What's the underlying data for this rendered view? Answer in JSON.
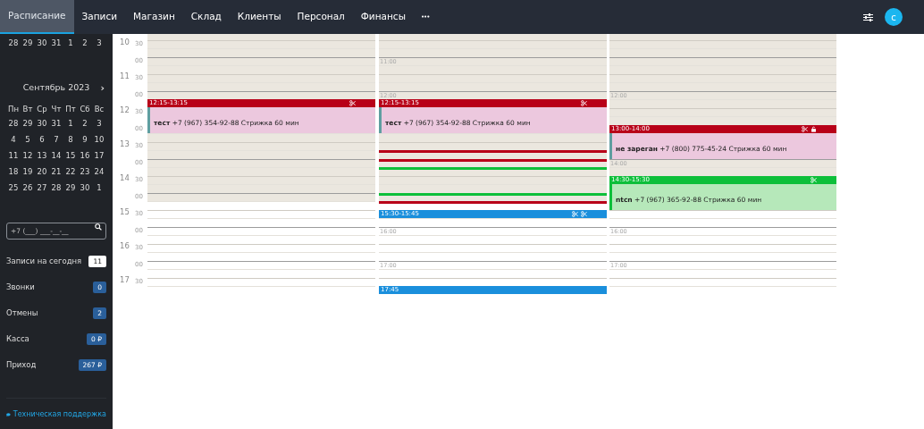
{
  "nav": {
    "tabs": [
      {
        "label": "Расписание",
        "selected": true
      },
      {
        "label": "Записи",
        "selected": false
      },
      {
        "label": "Магазин",
        "selected": false
      },
      {
        "label": "Склад",
        "selected": false
      },
      {
        "label": "Клиенты",
        "selected": false
      },
      {
        "label": "Персонал",
        "selected": false
      },
      {
        "label": "Финансы",
        "selected": false
      }
    ],
    "more": "•••",
    "avatar": "с"
  },
  "sidebar": {
    "prev_week": [
      "28",
      "29",
      "30",
      "31",
      "1",
      "2",
      "3"
    ],
    "calendar": {
      "title": "Сентябрь 2023",
      "next": "›",
      "weekdays": [
        "Пн",
        "Вт",
        "Ср",
        "Чт",
        "Пт",
        "Сб",
        "Вс"
      ],
      "weeks": [
        [
          "28",
          "29",
          "30",
          "31",
          "1",
          "2",
          "3"
        ],
        [
          "4",
          "5",
          "6",
          "7",
          "8",
          "9",
          "10"
        ],
        [
          "11",
          "12",
          "13",
          "14",
          "15",
          "16",
          "17"
        ],
        [
          "18",
          "19",
          "20",
          "21",
          "22",
          "23",
          "24"
        ],
        [
          "25",
          "26",
          "27",
          "28",
          "29",
          "30",
          "1"
        ]
      ]
    },
    "search": {
      "placeholder": "+7 (___) ___-__-__"
    },
    "stats": [
      {
        "label": "Записи на сегодня",
        "value": "11",
        "kind": "light"
      },
      {
        "label": "Звонки",
        "value": "0",
        "kind": "dark"
      },
      {
        "label": "Отмены",
        "value": "2",
        "kind": "dark"
      },
      {
        "label": "Касса",
        "value": "0 ₽",
        "kind": "dark"
      },
      {
        "label": "Приход",
        "value": "267 ₽",
        "kind": "dark"
      }
    ],
    "support": "Техническая поддержка"
  },
  "schedule": {
    "time_labels": [
      {
        "hour": "10",
        "minute": "30"
      },
      {
        "minute": "00"
      },
      {
        "hour": "11",
        "minute": "30"
      },
      {
        "minute": "00"
      },
      {
        "hour": "12",
        "minute": "30"
      },
      {
        "minute": "00"
      },
      {
        "hour": "13",
        "minute": "30"
      },
      {
        "minute": "00"
      },
      {
        "hour": "14",
        "minute": "30"
      },
      {
        "minute": "00"
      },
      {
        "hour": "15",
        "minute": "30"
      },
      {
        "minute": "00"
      },
      {
        "hour": "16",
        "minute": "30"
      },
      {
        "minute": "00"
      },
      {
        "hour": "17",
        "minute": "30"
      }
    ],
    "columns": [
      {
        "slots": [
          {
            "kind": "closed"
          },
          {
            "kind": "closed"
          },
          {
            "kind": "closed"
          },
          {
            "kind": "closed"
          },
          {
            "kind": "closed"
          },
          {
            "kind": "closed"
          },
          {
            "kind": "closed"
          },
          {
            "kind": "closed"
          },
          {
            "kind": "closed",
            "events": [
              {
                "kind": "full",
                "color": "#b80018",
                "time": "12:15-13:15",
                "client": "тест",
                "details": "+7 (967) 354-92-88 Стрижка 60 мин",
                "service": true,
                "master": false,
                "locked": false
              }
            ]
          },
          {
            "kind": "closed"
          },
          {
            "kind": "closed"
          },
          {
            "kind": "closed"
          },
          {
            "kind": "closed"
          },
          {
            "kind": "closed"
          },
          {
            "kind": "closed"
          },
          {
            "kind": "closed"
          },
          {
            "kind": "closed"
          },
          {
            "kind": "closed"
          },
          {
            "kind": "closed"
          },
          {
            "kind": "closed"
          },
          {
            "kind": "open"
          },
          {
            "kind": "open"
          },
          {
            "kind": "open"
          },
          {
            "kind": "open"
          },
          {
            "kind": "open"
          },
          {
            "kind": "open"
          },
          {
            "kind": "open"
          },
          {
            "kind": "open"
          },
          {
            "kind": "open"
          },
          {
            "kind": "open"
          },
          {
            "kind": "open"
          }
        ]
      },
      {
        "slots": [
          {
            "kind": "closed"
          },
          {
            "kind": "closed"
          },
          {
            "kind": "closed"
          },
          {
            "kind": "closed",
            "mark": "11:00"
          },
          {
            "kind": "closed"
          },
          {
            "kind": "closed"
          },
          {
            "kind": "closed"
          },
          {
            "kind": "closed",
            "mark": "12:00"
          },
          {
            "kind": "closed",
            "events": [
              {
                "kind": "full",
                "color": "#b80018",
                "time": "12:15-13:15",
                "client": "тест",
                "details": "+7 (967) 354-92-88 Стрижка 60 мин",
                "service": true,
                "master": false,
                "locked": false
              }
            ]
          },
          {
            "kind": "closed"
          },
          {
            "kind": "closed"
          },
          {
            "kind": "closed"
          },
          {
            "kind": "closed"
          },
          {
            "kind": "closed"
          },
          {
            "kind": "closed",
            "events": [
              {
                "kind": "collapsed",
                "color": "#b80018"
              }
            ]
          },
          {
            "kind": "closed",
            "events": [
              {
                "kind": "collapsed",
                "color": "#b80018"
              }
            ]
          },
          {
            "kind": "closed",
            "events": [
              {
                "kind": "collapsed",
                "color": "#0dbf3a"
              }
            ]
          },
          {
            "kind": "closed"
          },
          {
            "kind": "closed"
          },
          {
            "kind": "closed",
            "events": [
              {
                "kind": "collapsed",
                "color": "#0dbf3a"
              }
            ]
          },
          {
            "kind": "open",
            "events": [
              {
                "kind": "collapsed",
                "color": "#b80018"
              }
            ]
          },
          {
            "kind": "open",
            "events": [
              {
                "kind": "header",
                "color": "#1a8fdc",
                "time": "15:30-15:45",
                "service": true,
                "master": true,
                "locked": false
              }
            ]
          },
          {
            "kind": "open"
          },
          {
            "kind": "open",
            "mark": "16:00"
          },
          {
            "kind": "open"
          },
          {
            "kind": "open"
          },
          {
            "kind": "open"
          },
          {
            "kind": "open",
            "mark": "17:00"
          },
          {
            "kind": "open"
          },
          {
            "kind": "open"
          },
          {
            "kind": "open",
            "events": [
              {
                "kind": "header",
                "color": "#1a8fdc",
                "time": "17:45",
                "service": false,
                "master": false,
                "locked": false
              }
            ]
          }
        ]
      },
      {
        "slots": [
          {
            "kind": "closed"
          },
          {
            "kind": "closed"
          },
          {
            "kind": "closed"
          },
          {
            "kind": "closed"
          },
          {
            "kind": "closed"
          },
          {
            "kind": "closed"
          },
          {
            "kind": "closed"
          },
          {
            "kind": "closed",
            "mark": "12:00"
          },
          {
            "kind": "closed"
          },
          {
            "kind": "closed"
          },
          {
            "kind": "closed"
          },
          {
            "kind": "closed",
            "events": [
              {
                "kind": "full",
                "color": "#b80018",
                "time": "13:00-14:00",
                "client": "не зареган",
                "details": "+7 (800) 775-45-24 Стрижка 60 мин",
                "service": true,
                "master": false,
                "locked": true
              }
            ]
          },
          {
            "kind": "closed"
          },
          {
            "kind": "closed"
          },
          {
            "kind": "closed"
          },
          {
            "kind": "closed",
            "mark": "14:00"
          },
          {
            "kind": "closed"
          },
          {
            "kind": "open",
            "events": [
              {
                "kind": "full",
                "color": "#0dbf3a",
                "time": "14:30-15:30",
                "client": "ntcn",
                "details": "+7 (967) 365-92-88 Стрижка 60 мин",
                "service": true,
                "master": false,
                "locked": false
              }
            ]
          },
          {
            "kind": "open"
          },
          {
            "kind": "open"
          },
          {
            "kind": "open"
          },
          {
            "kind": "open"
          },
          {
            "kind": "open"
          },
          {
            "kind": "open",
            "mark": "16:00"
          },
          {
            "kind": "open"
          },
          {
            "kind": "open"
          },
          {
            "kind": "open"
          },
          {
            "kind": "open",
            "mark": "17:00"
          },
          {
            "kind": "open"
          },
          {
            "kind": "open"
          },
          {
            "kind": "open"
          }
        ]
      }
    ]
  }
}
